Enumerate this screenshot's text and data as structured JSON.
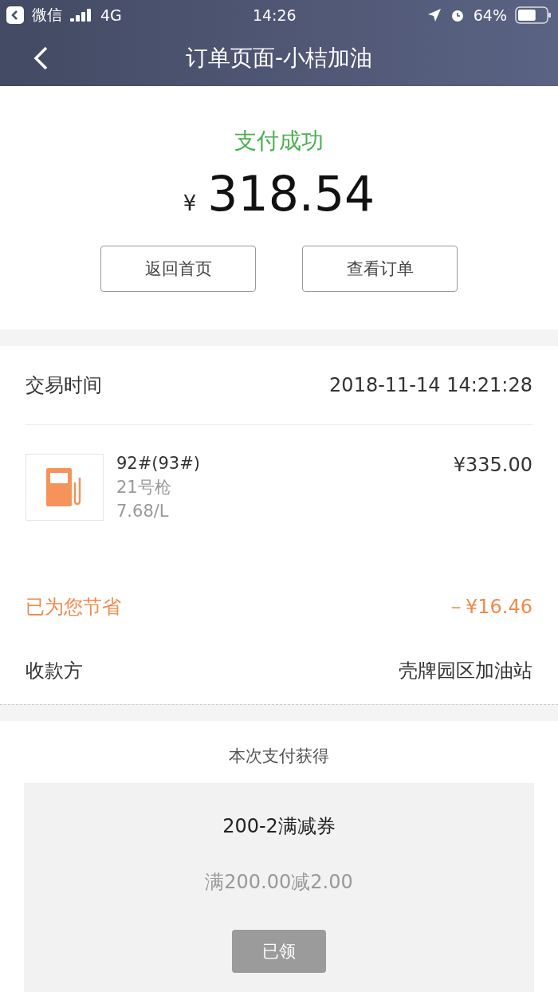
{
  "status_bar": {
    "back_app": "微信",
    "network": "4G",
    "time": "14:26",
    "battery": "64%"
  },
  "nav": {
    "title": "订单页面-小桔加油"
  },
  "result": {
    "status": "支付成功",
    "currency": "¥",
    "amount": "318.54",
    "buttons": [
      "返回首页",
      "查看订单"
    ]
  },
  "details": {
    "time_label": "交易时间",
    "time_value": "2018-11-14 14:21:28",
    "item": {
      "name": "92#(93#)",
      "nozzle": "21号枪",
      "unit_price": "7.68/L",
      "price": "¥335.00"
    },
    "savings_label": "已为您节省",
    "savings_value": "－¥16.46",
    "payee_label": "收款方",
    "payee_value": "壳牌园区加油站"
  },
  "reward": {
    "title": "本次支付获得",
    "coupon": {
      "name": "200-2满减券",
      "description": "满200.00减2.00",
      "button": "已领",
      "disabled": true
    }
  }
}
